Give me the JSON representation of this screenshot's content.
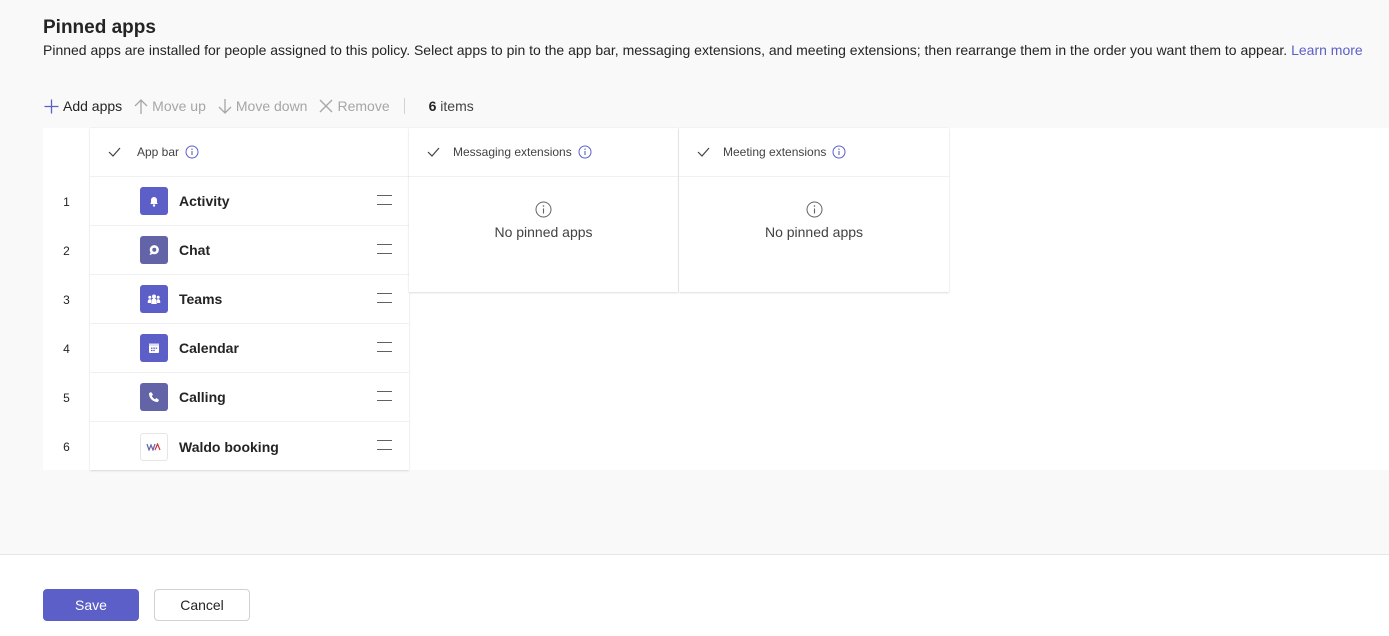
{
  "header": {
    "title": "Pinned apps",
    "description": "Pinned apps are installed for people assigned to this policy. Select apps to pin to the app bar, messaging extensions, and meeting extensions; then rearrange them in the order you want them to appear.",
    "learn_more": "Learn more"
  },
  "toolbar": {
    "add_apps": "Add apps",
    "move_up": "Move up",
    "move_down": "Move down",
    "remove": "Remove",
    "count_number": "6",
    "count_label": "items"
  },
  "columns": {
    "app_bar": "App bar",
    "messaging_extensions": "Messaging extensions",
    "meeting_extensions": "Meeting extensions"
  },
  "apps": [
    {
      "num": "1",
      "name": "Activity",
      "icon": "bell-icon"
    },
    {
      "num": "2",
      "name": "Chat",
      "icon": "chat-icon"
    },
    {
      "num": "3",
      "name": "Teams",
      "icon": "people-icon"
    },
    {
      "num": "4",
      "name": "Calendar",
      "icon": "calendar-icon"
    },
    {
      "num": "5",
      "name": "Calling",
      "icon": "phone-icon"
    },
    {
      "num": "6",
      "name": "Waldo booking",
      "icon": "waldo-logo-icon"
    }
  ],
  "empty_state": {
    "messaging": "No pinned apps",
    "meeting": "No pinned apps"
  },
  "footer": {
    "save": "Save",
    "cancel": "Cancel"
  },
  "colors": {
    "accent": "#5b5fc7",
    "text": "#242424",
    "disabled": "#a6a6a6"
  }
}
